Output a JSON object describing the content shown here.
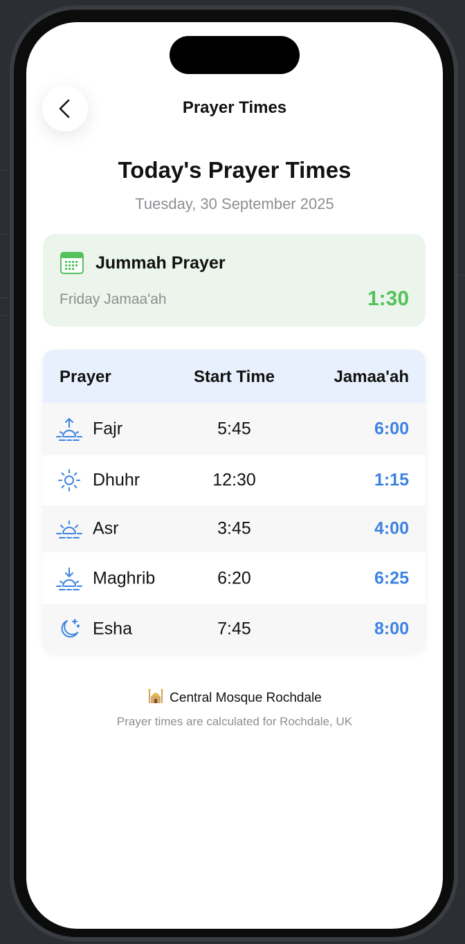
{
  "header": {
    "title": "Prayer Times",
    "back_icon": "chevron-left-icon"
  },
  "main": {
    "title": "Today's Prayer Times",
    "date": "Tuesday, 30 September 2025"
  },
  "jummah": {
    "icon": "calendar-icon",
    "title": "Jummah Prayer",
    "subtitle": "Friday Jamaa'ah",
    "time": "1:30",
    "accent_color": "#54c15b",
    "background_color": "#ebf5eb"
  },
  "table": {
    "columns": [
      "Prayer",
      "Start Time",
      "Jamaa'ah"
    ],
    "header_background": "#e7f0fc",
    "jamaah_color": "#3b82e0",
    "rows": [
      {
        "icon": "sunrise-icon",
        "name": "Fajr",
        "start": "5:45",
        "jamaah": "6:00"
      },
      {
        "icon": "sun-icon",
        "name": "Dhuhr",
        "start": "12:30",
        "jamaah": "1:15"
      },
      {
        "icon": "sun-horizon-icon",
        "name": "Asr",
        "start": "3:45",
        "jamaah": "4:00"
      },
      {
        "icon": "sunset-icon",
        "name": "Maghrib",
        "start": "6:20",
        "jamaah": "6:25"
      },
      {
        "icon": "moon-stars-icon",
        "name": "Esha",
        "start": "7:45",
        "jamaah": "8:00"
      }
    ]
  },
  "footer": {
    "icon": "mosque-icon",
    "mosque": "Central Mosque Rochdale",
    "note": "Prayer times are calculated for Rochdale, UK"
  }
}
